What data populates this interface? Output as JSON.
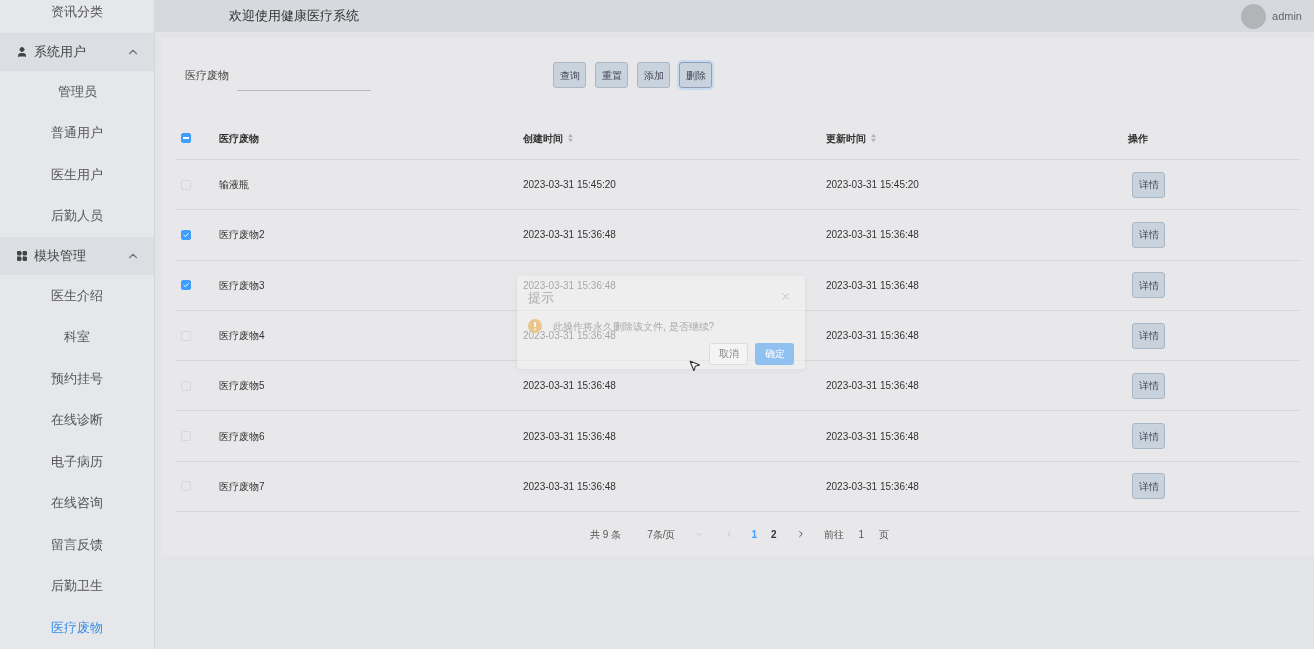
{
  "header": {
    "title": "欢迎使用健康医疗系统",
    "user": "admin"
  },
  "sidebar": {
    "items": [
      {
        "kind": "item",
        "label": "资讯分类",
        "selected": false
      },
      {
        "kind": "group",
        "label": "系统用户",
        "expanded": true,
        "children": [
          {
            "kind": "item",
            "label": "管理员",
            "selected": false
          },
          {
            "kind": "item",
            "label": "普通用户",
            "selected": false
          },
          {
            "kind": "item",
            "label": "医生用户",
            "selected": false
          },
          {
            "kind": "item",
            "label": "后勤人员",
            "selected": false
          }
        ]
      },
      {
        "kind": "group",
        "label": "模块管理",
        "expanded": true,
        "children": [
          {
            "kind": "item",
            "label": "医生介绍",
            "selected": false
          },
          {
            "kind": "item",
            "label": "科室",
            "selected": false
          },
          {
            "kind": "item",
            "label": "预约挂号",
            "selected": false
          },
          {
            "kind": "item",
            "label": "在线诊断",
            "selected": false
          },
          {
            "kind": "item",
            "label": "电子病历",
            "selected": false
          },
          {
            "kind": "item",
            "label": "在线咨询",
            "selected": false
          },
          {
            "kind": "item",
            "label": "留言反馈",
            "selected": false
          },
          {
            "kind": "item",
            "label": "后勤卫生",
            "selected": false
          },
          {
            "kind": "item",
            "label": "医疗废物",
            "selected": true
          }
        ]
      }
    ]
  },
  "search": {
    "label": "医疗废物"
  },
  "buttons": [
    {
      "label": "查询",
      "focused": false
    },
    {
      "label": "重置",
      "focused": false
    },
    {
      "label": "添加",
      "focused": false
    },
    {
      "label": "删除",
      "focused": true
    }
  ],
  "table": {
    "select_all_indeterminate": true,
    "columns": [
      {
        "label": "医疗废物",
        "sortable": false
      },
      {
        "label": "创建时间",
        "sortable": true
      },
      {
        "label": "更新时间",
        "sortable": true
      },
      {
        "label": "操作",
        "sortable": false
      }
    ],
    "rows": [
      {
        "checked": false,
        "name": "输液瓶",
        "created": "2023-03-31 15:45:20",
        "updated": "2023-03-31 15:45:20",
        "action": "详情"
      },
      {
        "checked": true,
        "name": "医疗废物2",
        "created": "2023-03-31 15:36:48",
        "updated": "2023-03-31 15:36:48",
        "action": "详情"
      },
      {
        "checked": true,
        "name": "医疗废物3",
        "created": "2023-03-31 15:36:48",
        "updated": "2023-03-31 15:36:48",
        "action": "详情"
      },
      {
        "checked": false,
        "name": "医疗废物4",
        "created": "2023-03-31 15:36:48",
        "updated": "2023-03-31 15:36:48",
        "action": "详情"
      },
      {
        "checked": false,
        "name": "医疗废物5",
        "created": "2023-03-31 15:36:48",
        "updated": "2023-03-31 15:36:48",
        "action": "详情"
      },
      {
        "checked": false,
        "name": "医疗废物6",
        "created": "2023-03-31 15:36:48",
        "updated": "2023-03-31 15:36:48",
        "action": "详情"
      },
      {
        "checked": false,
        "name": "医疗废物7",
        "created": "2023-03-31 15:36:48",
        "updated": "2023-03-31 15:36:48",
        "action": "详情"
      }
    ]
  },
  "pagination": {
    "total": "共 9 条",
    "page_size": "7条/页",
    "pages": [
      {
        "label": "1",
        "selected": true
      },
      {
        "label": "2",
        "selected": false
      }
    ],
    "goto_label": "前往",
    "goto_value": "1",
    "goto_suffix": "页"
  },
  "dialog": {
    "title": "提示",
    "message": "此操作将永久删除该文件, 是否继续?",
    "cancel": "取消",
    "confirm": "确定"
  }
}
